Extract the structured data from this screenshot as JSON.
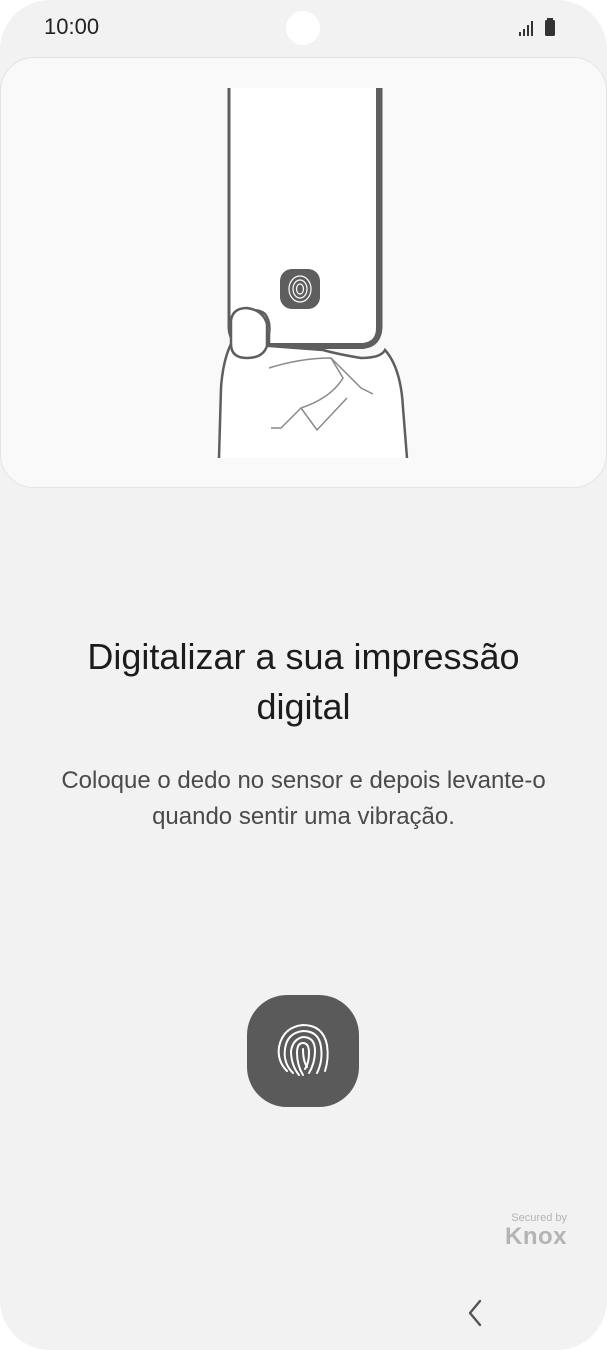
{
  "status_bar": {
    "time": "10:00",
    "icons": [
      "signal-icon",
      "battery-icon"
    ]
  },
  "illustration": {
    "description_icon": "hand-holding-phone-icon",
    "sensor_icon": "fingerprint-icon"
  },
  "content": {
    "title": "Digitalizar a sua impressão digital",
    "subtitle": "Coloque o dedo no sensor e depois levante-o quando sentir uma vibração."
  },
  "fingerprint_button": {
    "icon": "fingerprint-icon",
    "color": "#5a5a5a"
  },
  "knox": {
    "secured_label": "Secured by",
    "brand": "Knox"
  },
  "nav_bar": {
    "back_icon": "chevron-left-icon"
  },
  "colors": {
    "background": "#f2f2f2",
    "card": "#f9f9f9",
    "title": "#1c1c1c",
    "subtitle": "#4a4a4a",
    "knox": "#b4b4b4"
  }
}
